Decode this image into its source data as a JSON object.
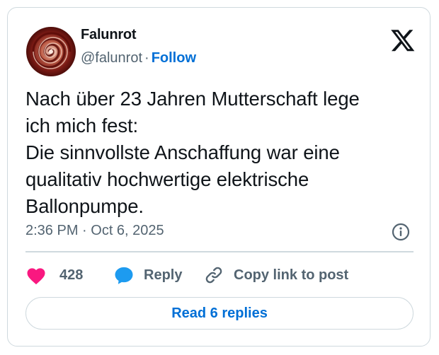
{
  "author": {
    "display_name": "Falunrot",
    "handle": "@falunrot",
    "separator": "·",
    "follow_label": "Follow",
    "avatar_icon": "red-spiral-avatar"
  },
  "brand": {
    "logo_icon": "x-logo-icon"
  },
  "tweet": {
    "text": "Nach über 23 Jahren Mutterschaft lege\nich mich fest:\nDie sinnvollste Anschaffung war eine\nqualitativ hochwertige elektrische\nBallonpumpe.",
    "timestamp": "2:36 PM · Oct 6, 2025"
  },
  "actions": {
    "like_count": "428",
    "reply_label": "Reply",
    "copy_link_label": "Copy link to post",
    "read_replies_label": "Read 6 replies"
  },
  "colors": {
    "like": "#f91880",
    "reply": "#1d9bf0",
    "link": "#006fd6",
    "text": "#0f1419",
    "secondary": "#536471",
    "border": "#cfd9de"
  }
}
